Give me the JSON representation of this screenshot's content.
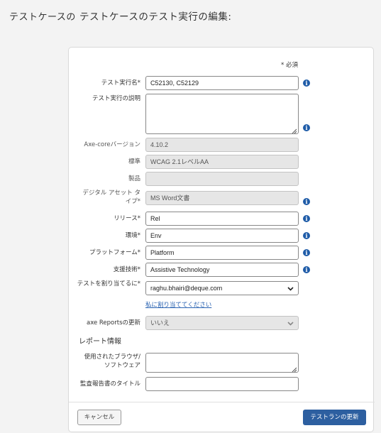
{
  "background": {
    "page_title": "テストケースの"
  },
  "modal": {
    "title": "テストケースのテスト実行の編集:",
    "required_note": "* 必須",
    "fields": {
      "test_run_name": {
        "label": "テスト実行名*",
        "value": "C52130, C52129"
      },
      "description": {
        "label": "テスト実行の説明",
        "value": ""
      },
      "axe_core_version": {
        "label": "Axe-coreバージョン",
        "value": "4.10.2"
      },
      "standard": {
        "label": "標準",
        "value": "WCAG 2.1レベルAA"
      },
      "product": {
        "label": "製品",
        "value": ""
      },
      "digital_asset_type": {
        "label": "デジタル アセット タイプ*",
        "value": "MS Word文書"
      },
      "release": {
        "label": "リリース*",
        "value": "Rel"
      },
      "environment": {
        "label": "環境*",
        "value": "Env"
      },
      "platform": {
        "label": "プラットフォーム*",
        "value": "Platform"
      },
      "assistive_tech": {
        "label": "支援技術*",
        "value": "Assistive Technology"
      },
      "assign_to": {
        "label": "テストを割り当てるに*",
        "value": "raghu.bhairi@deque.com",
        "assign_me_link": "私に割り当ててください"
      },
      "axe_reports_update": {
        "label": "axe Reportsの更新",
        "value": "いいえ"
      }
    },
    "report_section": {
      "heading": "レポート情報",
      "browser_software": {
        "label": "使用されたブラウザ/ソフトウェア",
        "value": ""
      },
      "audit_report_title": {
        "label": "監査報告書のタイトル",
        "value": ""
      }
    },
    "buttons": {
      "cancel": "キャンセル",
      "update": "テストランの更新"
    }
  },
  "colors": {
    "primary": "#2d5fa0",
    "info_icon": "#1f5ca8",
    "link": "#2a63b2"
  }
}
